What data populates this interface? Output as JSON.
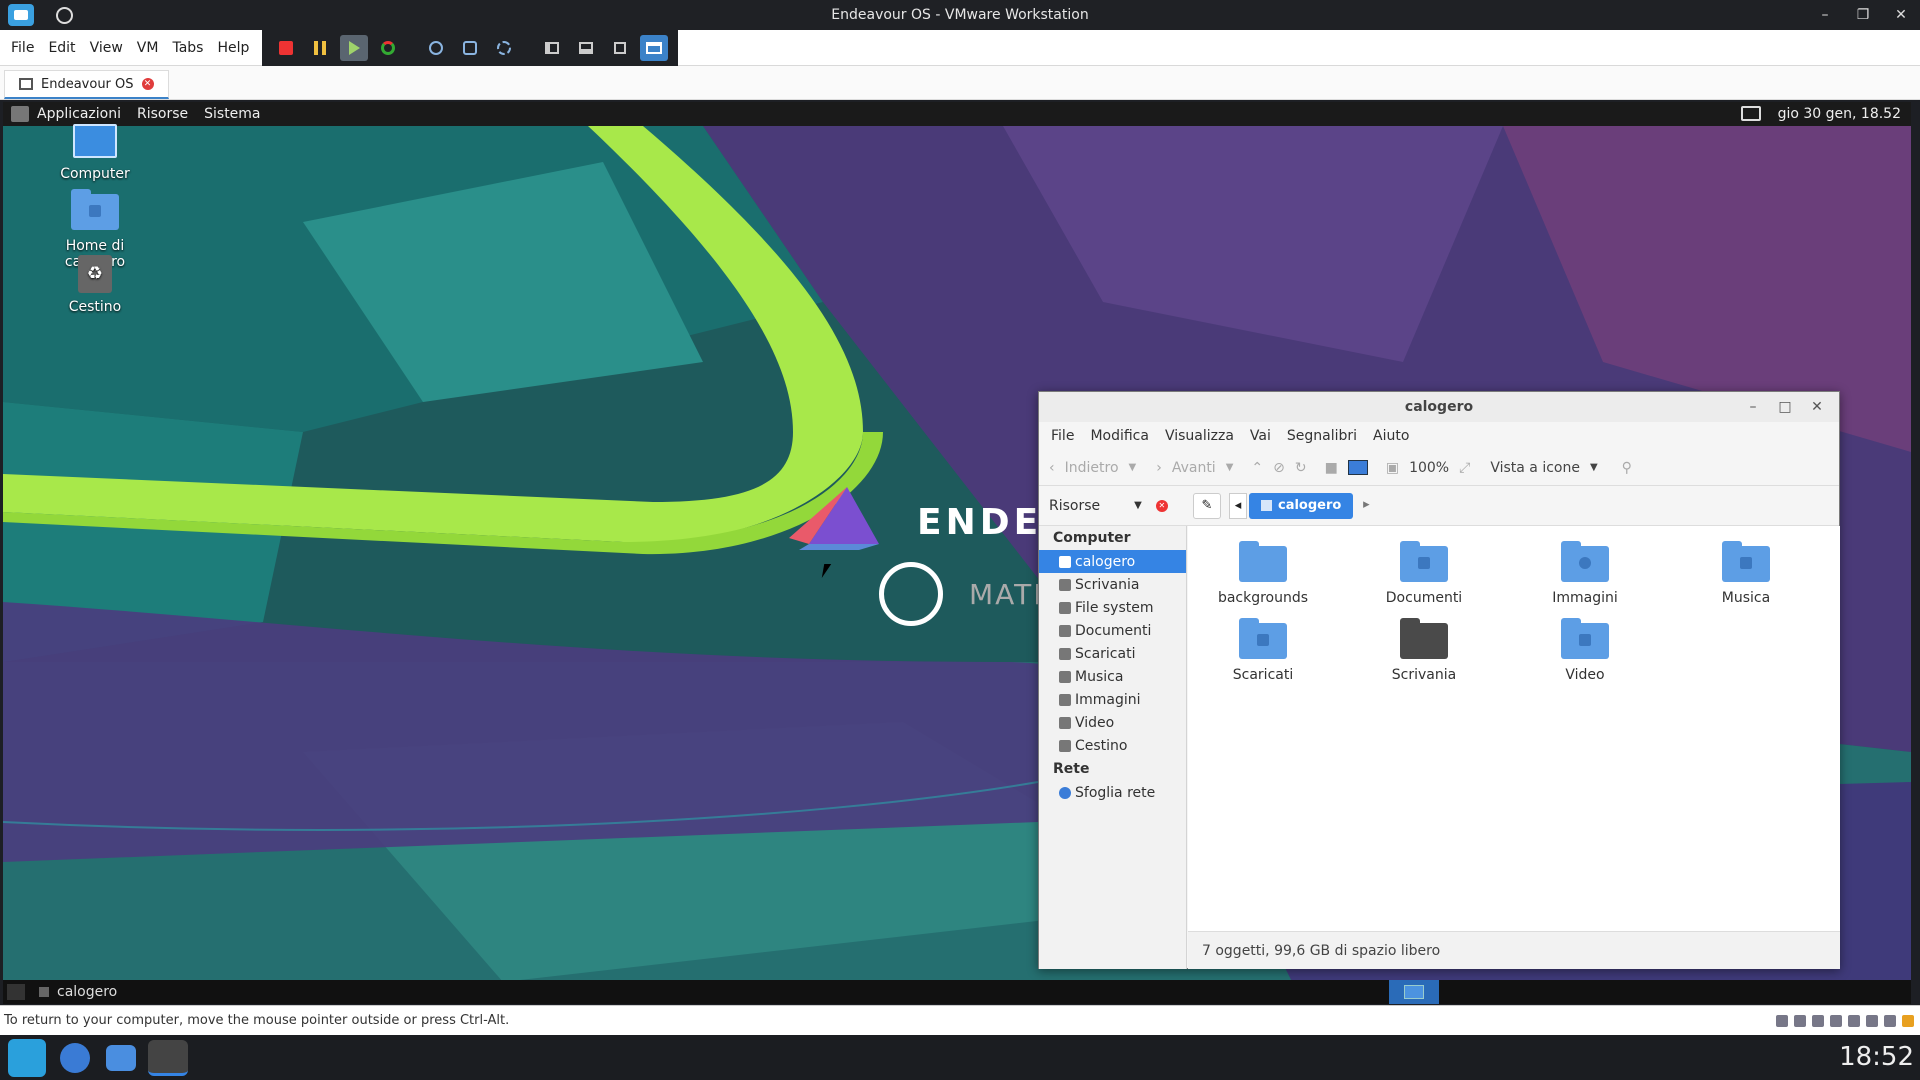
{
  "window": {
    "title": "Endeavour OS - VMware Workstation"
  },
  "vm_menu": [
    "File",
    "Edit",
    "View",
    "VM",
    "Tabs",
    "Help"
  ],
  "vm_tab": {
    "label": "Endeavour OS"
  },
  "guest_panel": {
    "menus": [
      "Applicazioni",
      "Risorse",
      "Sistema"
    ],
    "clock": "gio 30 gen, 18.52"
  },
  "desktop_icons": [
    {
      "label": "Computer"
    },
    {
      "label": "Home di calogero"
    },
    {
      "label": "Cestino"
    }
  ],
  "logo": {
    "text1": "ENDEAVO",
    "text2": "MATE"
  },
  "filemanager": {
    "title": "calogero",
    "menu": [
      "File",
      "Modifica",
      "Visualizza",
      "Vai",
      "Segnalibri",
      "Aiuto"
    ],
    "toolbar": {
      "back": "Indietro",
      "forward": "Avanti",
      "zoom": "100%",
      "view_mode": "Vista a icone"
    },
    "sidebar_selector": "Risorse",
    "path_button": "calogero",
    "sidebar": {
      "heading_computer": "Computer",
      "items": [
        "calogero",
        "Scrivania",
        "File system",
        "Documenti",
        "Scaricati",
        "Musica",
        "Immagini",
        "Video",
        "Cestino"
      ],
      "heading_network": "Rete",
      "network_items": [
        "Sfoglia rete"
      ]
    },
    "files": [
      "backgrounds",
      "Documenti",
      "Immagini",
      "Musica",
      "Scaricati",
      "Scrivania",
      "Video"
    ],
    "status": "7 oggetti, 99,6  GB di spazio libero"
  },
  "guest_bottom": {
    "window_label": "calogero"
  },
  "vm_status": "To return to your computer, move the mouse pointer outside or press Ctrl-Alt.",
  "host_clock": "18:52"
}
